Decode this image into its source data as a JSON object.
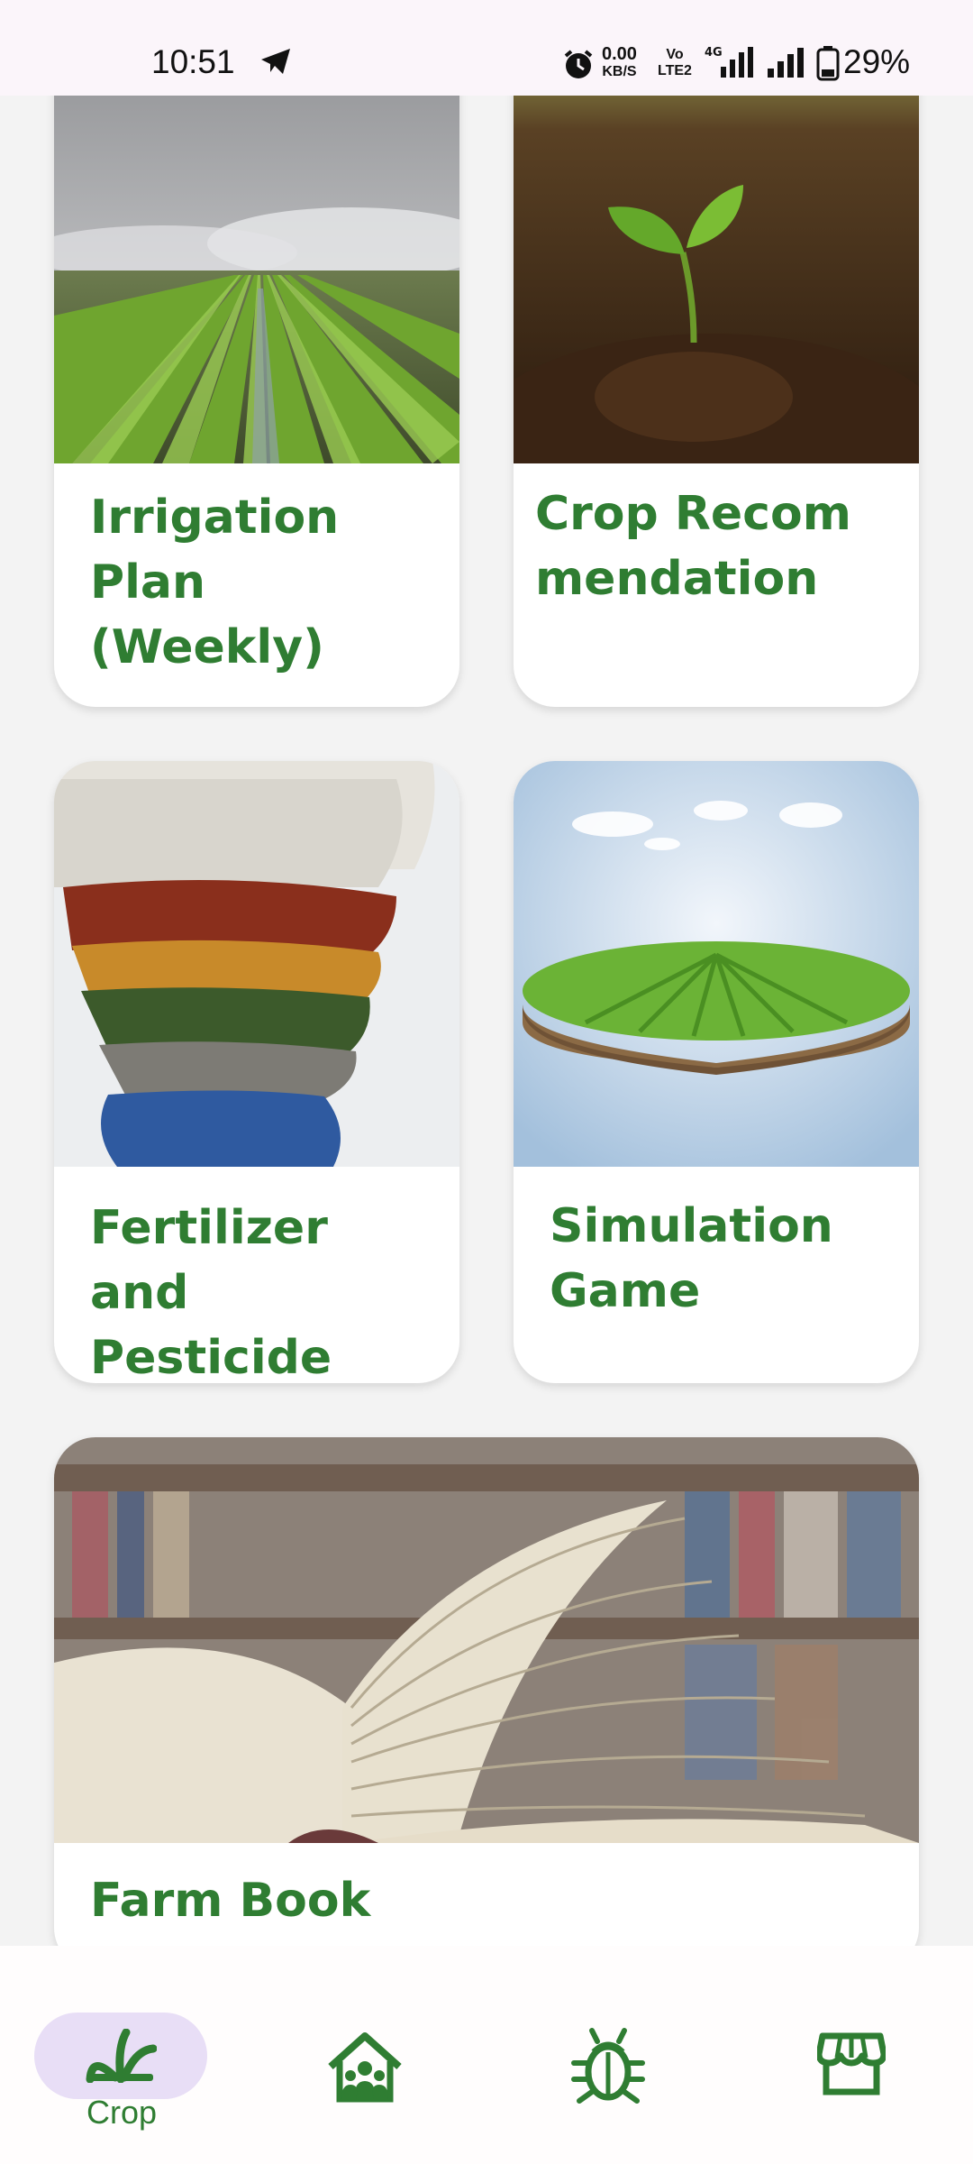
{
  "status_bar": {
    "time": "10:51",
    "net_speed_value": "0.00",
    "net_speed_unit": "KB/S",
    "volte_top": "Vo",
    "volte_bottom": "LTE2",
    "network_type": "4G",
    "battery": "29%"
  },
  "cards": [
    {
      "title": "Irrigation Plan (Weekly)",
      "image": "irrigated-field-image"
    },
    {
      "title": "Crop Recommendation",
      "image": "seedling-image"
    },
    {
      "title": "Fertilizer and Pesticide Pedia",
      "image": "fertilizer-granules-image"
    },
    {
      "title": "Simulation Game",
      "image": "floating-farm-image"
    },
    {
      "title": "Farm Book",
      "image": "open-book-image"
    }
  ],
  "bottom_nav": {
    "items": [
      {
        "label": "Crop",
        "icon": "crop-icon",
        "active": true
      },
      {
        "icon": "community-home-icon"
      },
      {
        "icon": "bug-icon"
      },
      {
        "icon": "store-icon"
      }
    ]
  },
  "colors": {
    "accent": "#2f7d32",
    "nav_active_bg": "#e8def6",
    "status_bar_bg": "#fbf5fa"
  }
}
